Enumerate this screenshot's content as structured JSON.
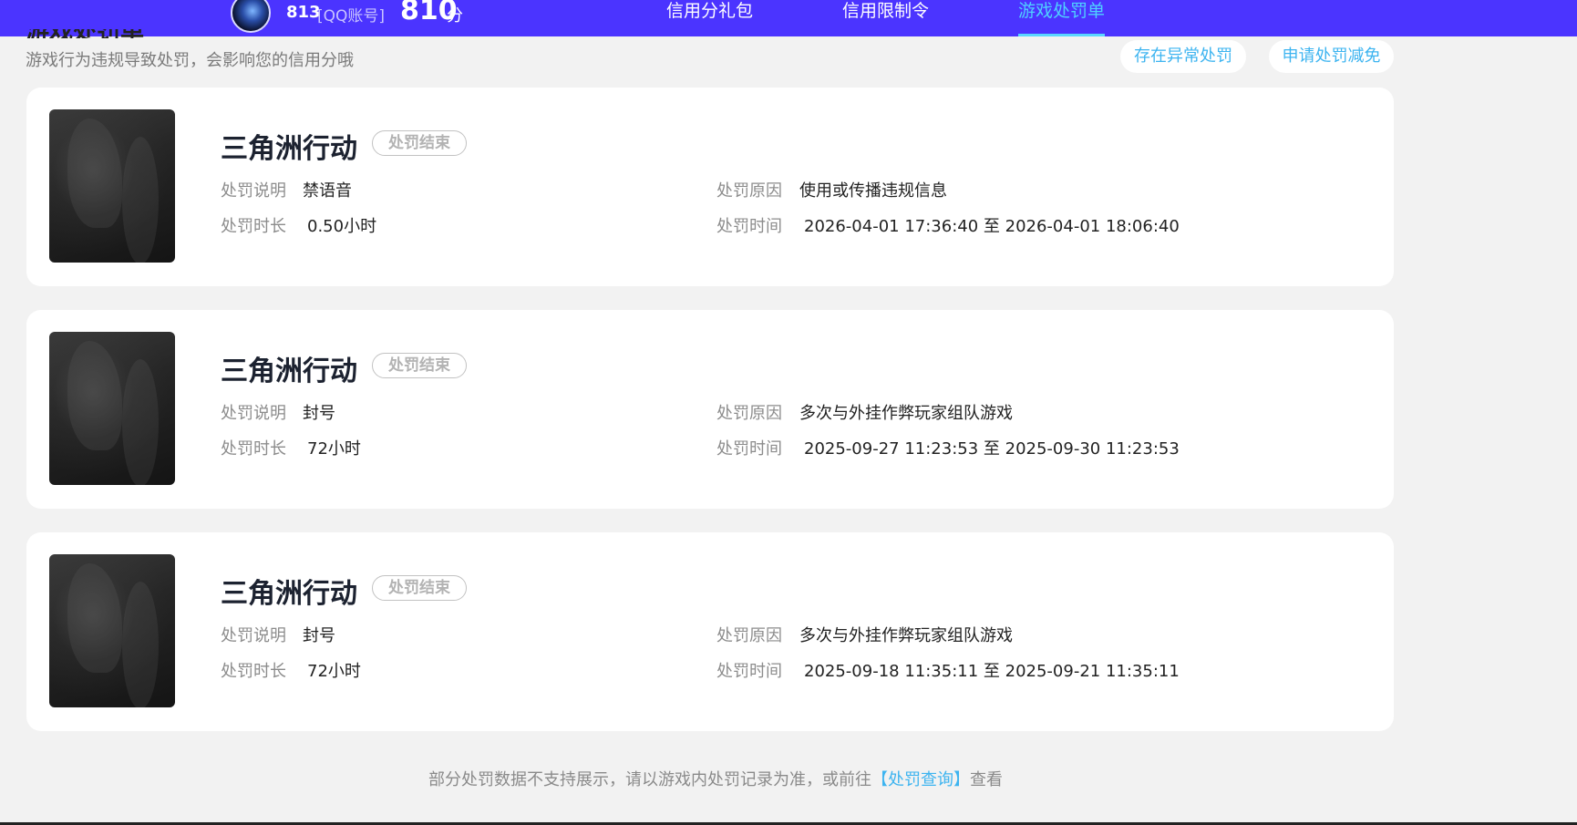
{
  "header": {
    "user_id": "813",
    "account_tag": "[QQ账号]",
    "score": "810",
    "score_unit": "分",
    "nav": [
      {
        "label": "信用分礼包"
      },
      {
        "label": "信用限制令"
      },
      {
        "label": "游戏处罚单"
      }
    ]
  },
  "section": {
    "subtitle": "游戏行为违规导致处罚，会影响您的信用分哦",
    "cut_title": "游戏处罚单",
    "abnormal_button": "存在异常处罚",
    "appeal_button": "申请处罚减免"
  },
  "labels": {
    "desc": "处罚说明",
    "duration": "处罚时长",
    "reason": "处罚原因",
    "time": "处罚时间"
  },
  "records": [
    {
      "game": "三角洲行动",
      "status": "处罚结束",
      "desc": "禁语音",
      "duration": "0.50小时",
      "reason": "使用或传播违规信息",
      "time": "2026-04-01 17:36:40 至 2026-04-01 18:06:40"
    },
    {
      "game": "三角洲行动",
      "status": "处罚结束",
      "desc": "封号",
      "duration": "72小时",
      "reason": "多次与外挂作弊玩家组队游戏",
      "time": "2025-09-27 11:23:53 至 2025-09-30 11:23:53"
    },
    {
      "game": "三角洲行动",
      "status": "处罚结束",
      "desc": "封号",
      "duration": "72小时",
      "reason": "多次与外挂作弊玩家组队游戏",
      "time": "2025-09-18 11:35:11 至 2025-09-21 11:35:11"
    }
  ],
  "footer": {
    "note_prefix": "部分处罚数据不支持展示，请以游戏内处罚记录为准，或前往",
    "link": "【处罚查询】",
    "note_suffix": "查看"
  }
}
